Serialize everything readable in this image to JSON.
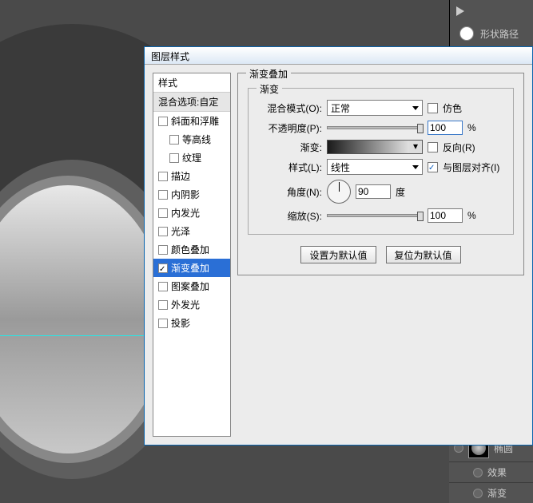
{
  "rightPanel": {
    "shapePathLabel": "形状路径",
    "layerName": "椭圆",
    "effectsLabel": "效果",
    "subEffect": "渐变"
  },
  "dialog": {
    "title": "图层样式",
    "styleHeader": "样式",
    "blendOptions": "混合选项:自定",
    "items": [
      {
        "label": "斜面和浮雕",
        "checked": false,
        "indent": false
      },
      {
        "label": "等高线",
        "checked": false,
        "indent": true
      },
      {
        "label": "纹理",
        "checked": false,
        "indent": true
      },
      {
        "label": "描边",
        "checked": false,
        "indent": false
      },
      {
        "label": "内阴影",
        "checked": false,
        "indent": false
      },
      {
        "label": "内发光",
        "checked": false,
        "indent": false
      },
      {
        "label": "光泽",
        "checked": false,
        "indent": false
      },
      {
        "label": "颜色叠加",
        "checked": false,
        "indent": false
      },
      {
        "label": "渐变叠加",
        "checked": true,
        "indent": false,
        "selected": true
      },
      {
        "label": "图案叠加",
        "checked": false,
        "indent": false
      },
      {
        "label": "外发光",
        "checked": false,
        "indent": false
      },
      {
        "label": "投影",
        "checked": false,
        "indent": false
      }
    ],
    "groupTitle": "渐变叠加",
    "innerTitle": "渐变",
    "labels": {
      "blendMode": "混合模式(O):",
      "opacity": "不透明度(P):",
      "gradient": "渐变:",
      "style": "样式(L):",
      "angle": "角度(N):",
      "scale": "缩放(S):",
      "dither": "仿色",
      "reverse": "反向(R)",
      "alignWithLayer": "与图层对齐(I)",
      "deg": "度",
      "pct": "%"
    },
    "values": {
      "blendMode": "正常",
      "opacity": "100",
      "style": "线性",
      "angle": "90",
      "scale": "100"
    },
    "buttons": {
      "makeDefault": "设置为默认值",
      "resetDefault": "复位为默认值"
    }
  }
}
